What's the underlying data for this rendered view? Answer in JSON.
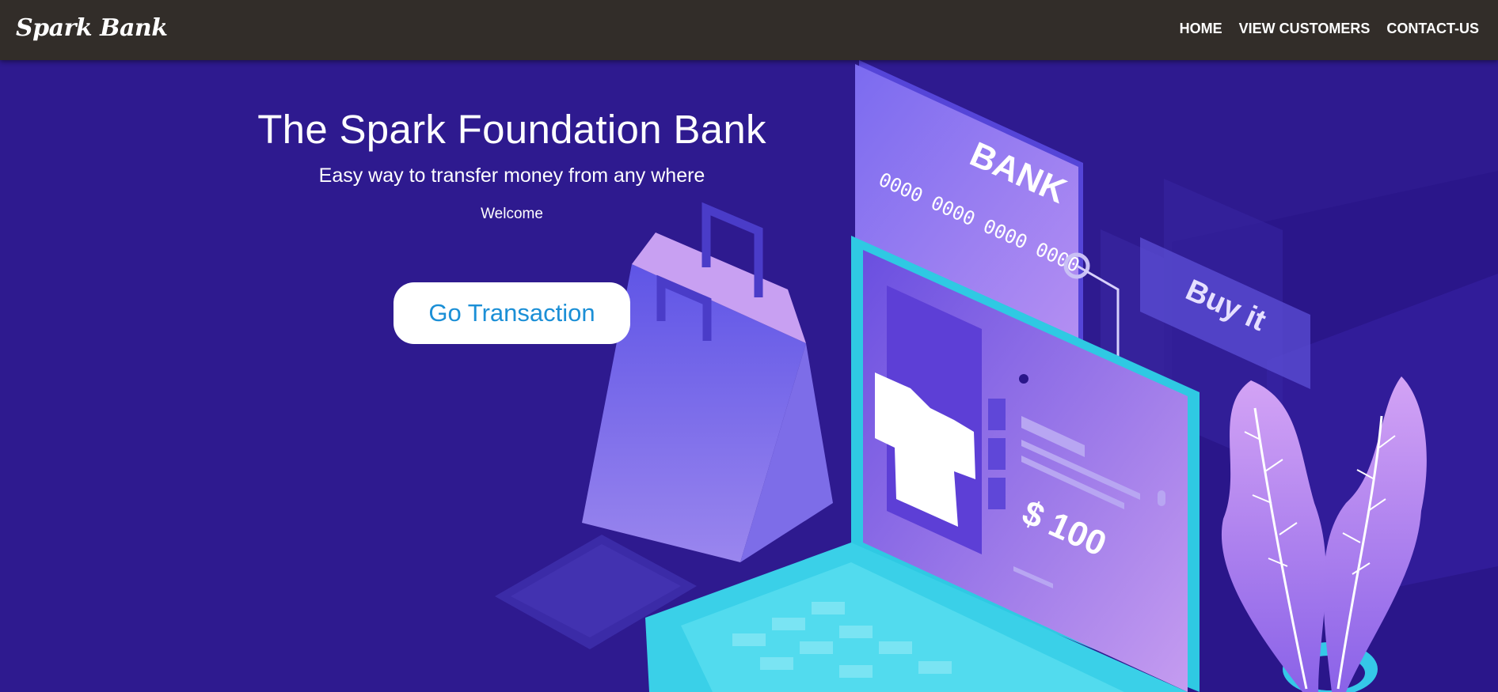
{
  "navbar": {
    "brand": "Spark Bank",
    "links": [
      {
        "label": "HOME"
      },
      {
        "label": "VIEW CUSTOMERS"
      },
      {
        "label": "CONTACT-US"
      }
    ]
  },
  "hero": {
    "title": "The Spark Foundation Bank",
    "subtitle": "Easy way to transfer money from any where",
    "welcome": "Welcome",
    "cta_label": "Go Transaction"
  },
  "illustration": {
    "card_label": "BANK",
    "card_number": "0000 0000 0000 0000",
    "tag_label": "Buy it",
    "price_label": "$ 100",
    "icons": [
      "credit-card-icon",
      "shopping-bag-icon",
      "laptop-icon",
      "t-shirt-icon",
      "plant-icon"
    ]
  },
  "colors": {
    "navbar_bg": "#322d29",
    "hero_bg": "#2e1a8f",
    "cta_bg": "#ffffff",
    "cta_text": "#1b8fd6",
    "text": "#ffffff"
  }
}
